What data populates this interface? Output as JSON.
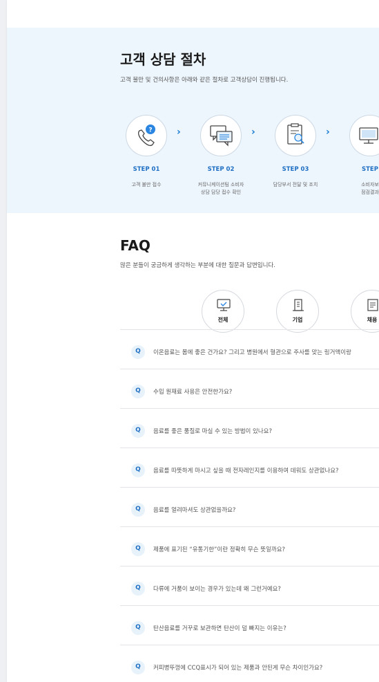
{
  "consult": {
    "title": "고객 상담 절차",
    "description": "고객 불만 및 건의사항은 아래와 같은 절차로 고객상담이 진행됩니다.",
    "steps": [
      {
        "num": "STEP 01",
        "desc1": "고객 불만 접수",
        "desc2": "",
        "icon": "phone-chat-icon"
      },
      {
        "num": "STEP 02",
        "desc1": "커뮤니케이션팀 소비자",
        "desc2": "상담 담당 접수 확인",
        "icon": "chat-bubbles-icon"
      },
      {
        "num": "STEP 03",
        "desc1": "담당부서 전달 및 조치",
        "desc2": "",
        "icon": "clipboard-search-icon"
      },
      {
        "num": "STEP",
        "desc1": "소비자보",
        "desc2": "점검결과",
        "icon": "monitor-icon"
      }
    ],
    "arrow": "›",
    "colors": {
      "accent": "#1e6fc4",
      "bg": "#eef6fd"
    }
  },
  "faq": {
    "title": "FAQ",
    "description": "많은 분들이 궁금하게 생각하는 부분에 대한 질문과 답변입니다.",
    "categories": [
      {
        "label": "전체",
        "icon": "monitor-check-icon"
      },
      {
        "label": "기업",
        "icon": "building-icon"
      },
      {
        "label": "채용",
        "icon": "document-icon"
      }
    ],
    "badge": "Q",
    "items": [
      "이온음료는 몸에 좋은 건가요? 그리고 병원에서 혈관으로 주사를 맞는 링거액이랑",
      "수입 원재료 사용은 안전한가요?",
      "음료를 좋은 품질로 마실 수 있는 방법이 있나요?",
      "음료를 따뜻하게 마시고 싶을 때 전자레인지를 이용하여 데워도 상관없나요?",
      "음료를 얼려마셔도 상관없을까요?",
      "제품에 표기된 “유통기한”이란 정확히 무슨 뜻일까요?",
      "다류에 거품이 보이는 경우가 있는데 왜 그런거예요?",
      "탄산음료를 거꾸로 보관하면 탄산이 덜 빠지는 이유는?",
      "커피병뚜껑에 CCQ표시가 되어 있는 제품과 안된게 무슨 차이인가요?"
    ]
  }
}
